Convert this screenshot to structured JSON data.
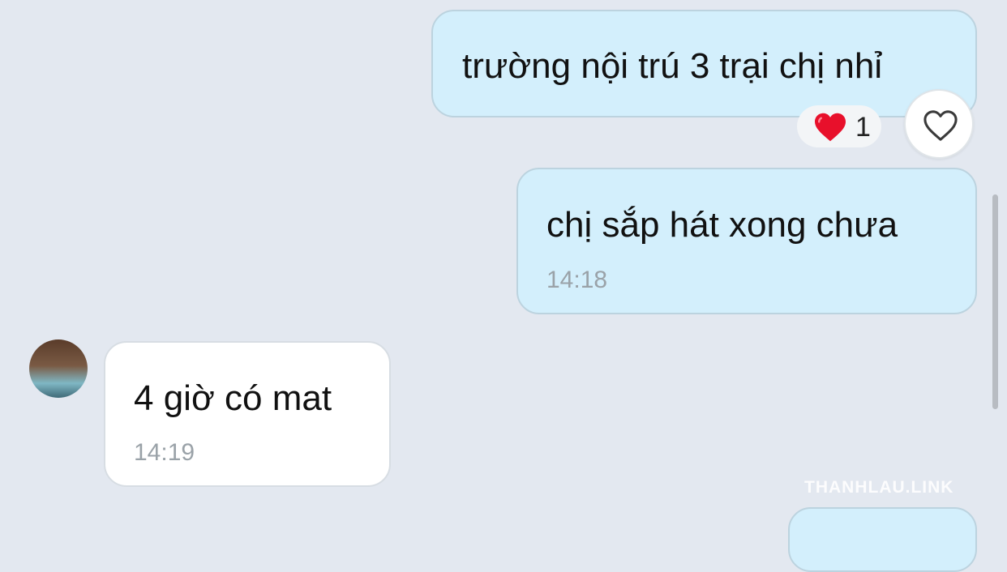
{
  "messages": [
    {
      "direction": "outgoing",
      "text": "trường nội trú 3 trại chị nhỉ",
      "reaction": {
        "icon": "red-heart-emoji",
        "count": "1"
      }
    },
    {
      "direction": "outgoing",
      "text": "chị sắp hát xong chưa",
      "time": "14:18"
    },
    {
      "direction": "incoming",
      "text": "4 giờ có mat",
      "time": "14:19"
    }
  ],
  "icons": {
    "like": "heart-outline-icon",
    "reaction": "red-heart-emoji",
    "avatar": "contact-avatar"
  },
  "watermark": "THANHLAU.LINK",
  "colors": {
    "background": "#e3e8f0",
    "outgoing_bubble": "#d3effc",
    "incoming_bubble": "#ffffff",
    "time_text": "#9aa2a8",
    "heart": "#e8102b"
  }
}
